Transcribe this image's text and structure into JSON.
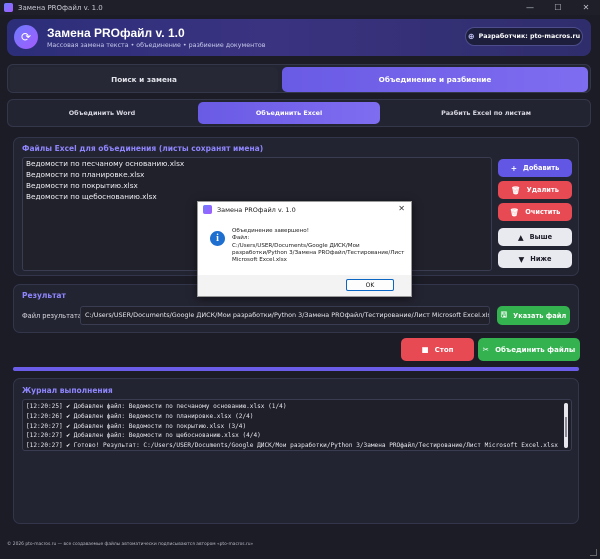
{
  "window": {
    "title": "Замена PROфайл v. 1.0",
    "min": "—",
    "max": "☐",
    "close": "✕"
  },
  "header": {
    "title": "Замена PROфайл v. 1.0",
    "subtitle": "Массовая замена текста  •  объединение  •  разбиение документов",
    "dev_label": "Разработчик: pto-macros.ru"
  },
  "tabs": [
    {
      "label": "Поиск и замена",
      "active": false
    },
    {
      "label": "Объединение и разбиение",
      "active": true
    }
  ],
  "subtabs": [
    {
      "label": "Объединить Word",
      "active": false
    },
    {
      "label": "Объединить Excel",
      "active": true
    },
    {
      "label": "Разбить Excel по листам",
      "active": false
    }
  ],
  "files_panel": {
    "title": "Файлы Excel для объединения (листы сохранят имена)",
    "files": [
      "Ведомости по песчаному основанию.xlsx",
      "Ведомости по планировке.xlsx",
      "Ведомости по покрытию.xlsx",
      "Ведомости по щебоснованию.xlsx"
    ],
    "buttons": {
      "add": "Добавить",
      "delete": "Удалить",
      "clear": "Очистить",
      "up": "Выше",
      "down": "Ниже"
    }
  },
  "result": {
    "title": "Результат",
    "file_label": "Файл результата:",
    "file_value": "C:/Users/USER/Documents/Google ДИСК/Мои разработки/Python 3/Замена PROфайл/Тестирование/Лист Microsoft Excel.xlsx",
    "choose_button": "Указать файл"
  },
  "actions": {
    "stop": "Стоп",
    "merge": "Объединить файлы"
  },
  "progress": {
    "percent": 100
  },
  "log": {
    "title": "Журнал выполнения",
    "lines": [
      {
        "time": "[12:20:25]",
        "text": " Добавлен файл: Ведомости по песчаному основанию.xlsx (1/4)"
      },
      {
        "time": "[12:20:26]",
        "text": " Добавлен файл: Ведомости по планировке.xlsx (2/4)"
      },
      {
        "time": "[12:20:27]",
        "text": " Добавлен файл: Ведомости по покрытию.xlsx (3/4)"
      },
      {
        "time": "[12:20:27]",
        "text": " Добавлен файл: Ведомости по щебоснованию.xlsx (4/4)"
      },
      {
        "time": "[12:20:27]",
        "text": " Готово! Результат: C:/Users/USER/Documents/Google ДИСК/Мои разработки/Python 3/Замена PROфайл/Тестирование/Лист Microsoft Excel.xlsx"
      }
    ]
  },
  "footer": "© 2026 pto-macros.ru — все создаваемые файлы автоматически подписываются автором «pto-macros.ru»",
  "dialog": {
    "title": "Замена PROфайл v. 1.0",
    "line1": "Объединение завершено!",
    "line2": "Файл:",
    "line3": "C:/Users/USER/Documents/Google ДИСК/Мои разработки/Python 3/Замена PROфайл/Тестирование/Лист Microsoft Excel.xlsx",
    "ok": "OK"
  },
  "colors": {
    "accent": "#6b5de8",
    "danger": "#e84a54",
    "success": "#33b24f",
    "background": "#1b1c26"
  }
}
